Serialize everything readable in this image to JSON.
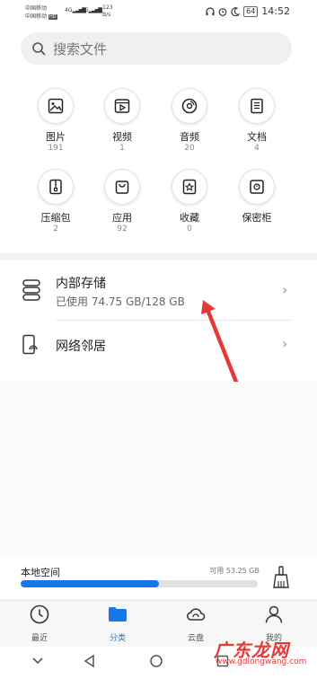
{
  "status_bar": {
    "carrier1": "中国移动",
    "carrier2": "中国移动",
    "sim1_tag": "HD",
    "net1": "4G",
    "net2": "4G",
    "speed_value": "123",
    "speed_unit": "B/s",
    "battery": "64",
    "time": "14:52"
  },
  "search": {
    "placeholder": "搜索文件"
  },
  "categories": [
    {
      "label": "图片",
      "count": "191",
      "icon": "image-icon"
    },
    {
      "label": "视频",
      "count": "1",
      "icon": "video-icon"
    },
    {
      "label": "音频",
      "count": "20",
      "icon": "audio-icon"
    },
    {
      "label": "文档",
      "count": "4",
      "icon": "document-icon"
    },
    {
      "label": "压缩包",
      "count": "2",
      "icon": "archive-icon"
    },
    {
      "label": "应用",
      "count": "92",
      "icon": "app-bag-icon"
    },
    {
      "label": "收藏",
      "count": "0",
      "icon": "favorite-star-icon"
    },
    {
      "label": "保密柜",
      "count": "",
      "icon": "safe-icon"
    }
  ],
  "internal_storage": {
    "title": "内部存储",
    "subtitle": "已使用 74.75 GB/128 GB",
    "icon": "storage-stack-icon"
  },
  "network": {
    "title": "网络邻居",
    "icon": "network-phone-icon"
  },
  "local_space": {
    "label": "本地空间",
    "free": "可用 53.25 GB",
    "used_fraction": 0.584,
    "clean_icon": "broom-icon"
  },
  "tabs": [
    {
      "label": "最近",
      "icon": "clock-icon",
      "active": false
    },
    {
      "label": "分类",
      "icon": "folder-icon",
      "active": true
    },
    {
      "label": "云盘",
      "icon": "cloud-icon",
      "active": false
    },
    {
      "label": "我的",
      "icon": "person-icon",
      "active": false
    }
  ],
  "colors": {
    "accent": "#1677e8",
    "annotation": "#e53935"
  },
  "watermark": {
    "text": "广东龙网",
    "sub": "www.gdlongwang.com"
  }
}
